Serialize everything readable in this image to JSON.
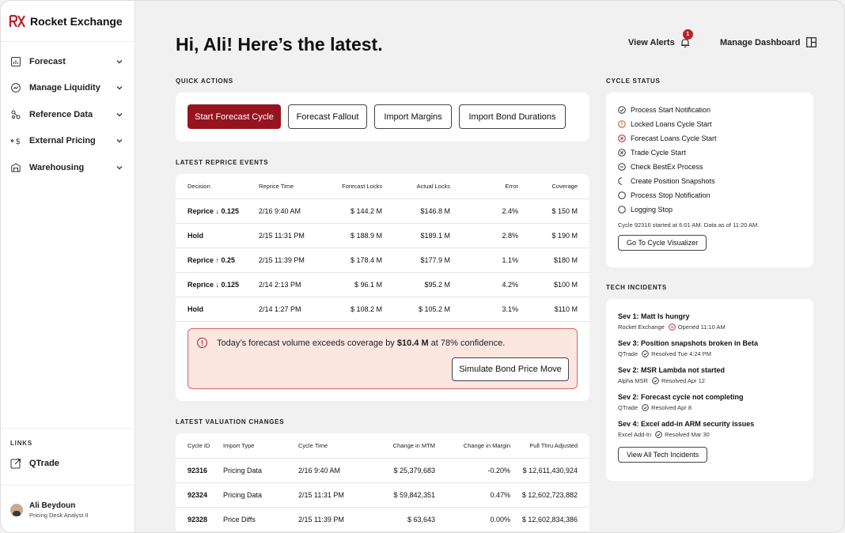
{
  "brand": {
    "name": "Rocket Exchange"
  },
  "colors": {
    "accent": "#96141f",
    "alert_bg": "#fbe6e0",
    "alert_border": "#d96b63",
    "error": "#b8222c"
  },
  "sidebar": {
    "items": [
      {
        "label": "Forecast",
        "icon": "bar-chart-icon"
      },
      {
        "label": "Manage Liquidity",
        "icon": "trend-icon"
      },
      {
        "label": "Reference Data",
        "icon": "nodes-icon"
      },
      {
        "label": "External Pricing",
        "icon": "exchange-dollar-icon"
      },
      {
        "label": "Warehousing",
        "icon": "warehouse-icon"
      }
    ],
    "links_header": "LINKS",
    "links": [
      {
        "label": "QTrade",
        "icon": "external-link-icon"
      }
    ],
    "user": {
      "name": "Ali Beydoun",
      "role": "Pricing Desk Analyst II"
    }
  },
  "header": {
    "greeting": "Hi, Ali! Here’s the latest.",
    "view_alerts": "View Alerts",
    "alerts_count": "1",
    "manage_dashboard": "Manage Dashboard"
  },
  "quick_actions": {
    "title": "QUICK ACTIONS",
    "buttons": [
      "Start Forecast Cycle",
      "Forecast Fallout",
      "Import Margins",
      "Import Bond Durations"
    ]
  },
  "reprice": {
    "title": "LATEST REPRICE EVENTS",
    "columns": [
      "Decision",
      "Reprice Time",
      "Forecast Locks",
      "Actual Locks",
      "Error",
      "Coverage"
    ],
    "rows": [
      [
        "Reprice ↓ 0.125",
        "2/16 9:40 AM",
        "$ 144.2 M",
        "$146.8 M",
        "2.4%",
        "$ 150 M"
      ],
      [
        "Hold",
        "2/15 11:31 PM",
        "$ 188.9 M",
        "$189.1 M",
        "2.8%",
        "$ 190 M"
      ],
      [
        "Reprice ↑ 0.25",
        "2/15 11:39 PM",
        "$ 178.4 M",
        "$177.9 M",
        "1.1%",
        "$180 M"
      ],
      [
        "Reprice ↓ 0.125",
        "2/14 2:13 PM",
        "$ 96.1 M",
        "$95.2 M",
        "4.2%",
        "$100 M"
      ],
      [
        "Hold",
        "2/14 1:27 PM",
        "$ 108.2 M",
        "$ 105.2 M",
        "3.1%",
        "$110 M"
      ]
    ],
    "alert": {
      "text_before": "Today’s forecast volume exceeds coverage by ",
      "amount": "$10.4 M",
      "text_after": " at 78% confidence.",
      "button": "Simulate Bond Price Move"
    }
  },
  "valuation": {
    "title": "LATEST VALUATION CHANGES",
    "columns": [
      "Cycle ID",
      "Import Type",
      "Cycle Time",
      "Change in MTM",
      "Change in Margin",
      "Pull Thru Adjusted"
    ],
    "rows": [
      [
        "92316",
        "Pricing Data",
        "2/16 9:40 AM",
        "$ 25,379,683",
        "-0.20%",
        "$ 12,611,430,924"
      ],
      [
        "92324",
        "Pricing Data",
        "2/15 11:31 PM",
        "$ 59,842,351",
        "0.47%",
        "$ 12,602,723,882"
      ],
      [
        "92328",
        "Price Diffs",
        "2/15 11:39 PM",
        "$ 63,643",
        "0.00%",
        "$ 12,602,834,386"
      ]
    ]
  },
  "cycle_status": {
    "title": "CYCLE STATUS",
    "items": [
      {
        "label": "Process Start Notification",
        "status": "check-circle-icon"
      },
      {
        "label": "Locked Loans Cycle Start",
        "status": "warning-circle-icon"
      },
      {
        "label": "Forecast Loans Cycle Start",
        "status": "error-circle-icon"
      },
      {
        "label": "Trade Cycle Start",
        "status": "x-circle-icon"
      },
      {
        "label": "Check BestEx Process",
        "status": "minus-circle-icon"
      },
      {
        "label": "Create Position Snapshots",
        "status": "spinner-icon"
      },
      {
        "label": "Process Stop Notification",
        "status": "empty-circle-icon"
      },
      {
        "label": "Logging Stop",
        "status": "empty-circle-icon"
      }
    ],
    "note": "Cycle 92316 started at 6:01 AM. Data as of 11:20 AM.",
    "button": "Go To Cycle Visualizer"
  },
  "tech_incidents": {
    "title": "TECH INCIDENTS",
    "items": [
      {
        "title": "Sev 1: Matt Is hungry",
        "source": "Rocket Exchange",
        "status": "Opened 11:10 AM",
        "icon": "minus-circle-red-icon"
      },
      {
        "title": "Sev 3: Position snapshots broken in Beta",
        "source": "QTrade",
        "status": "Resolved Tue 4:24 PM",
        "icon": "check-circle-icon"
      },
      {
        "title": "Sev 2: MSR Lambda not started",
        "source": "Alpha MSR",
        "status": "Resolved Apr 12",
        "icon": "check-circle-icon"
      },
      {
        "title": "Sev 2: Forecast cycle not completing",
        "source": "QTrade",
        "status": "Resolved Apr 8",
        "icon": "check-circle-icon"
      },
      {
        "title": "Sev 4: Excel add-in ARM security issues",
        "source": "Excel Add-In",
        "status": "Resolved Mar 30",
        "icon": "check-circle-icon"
      }
    ],
    "button": "View All Tech Incidents"
  }
}
